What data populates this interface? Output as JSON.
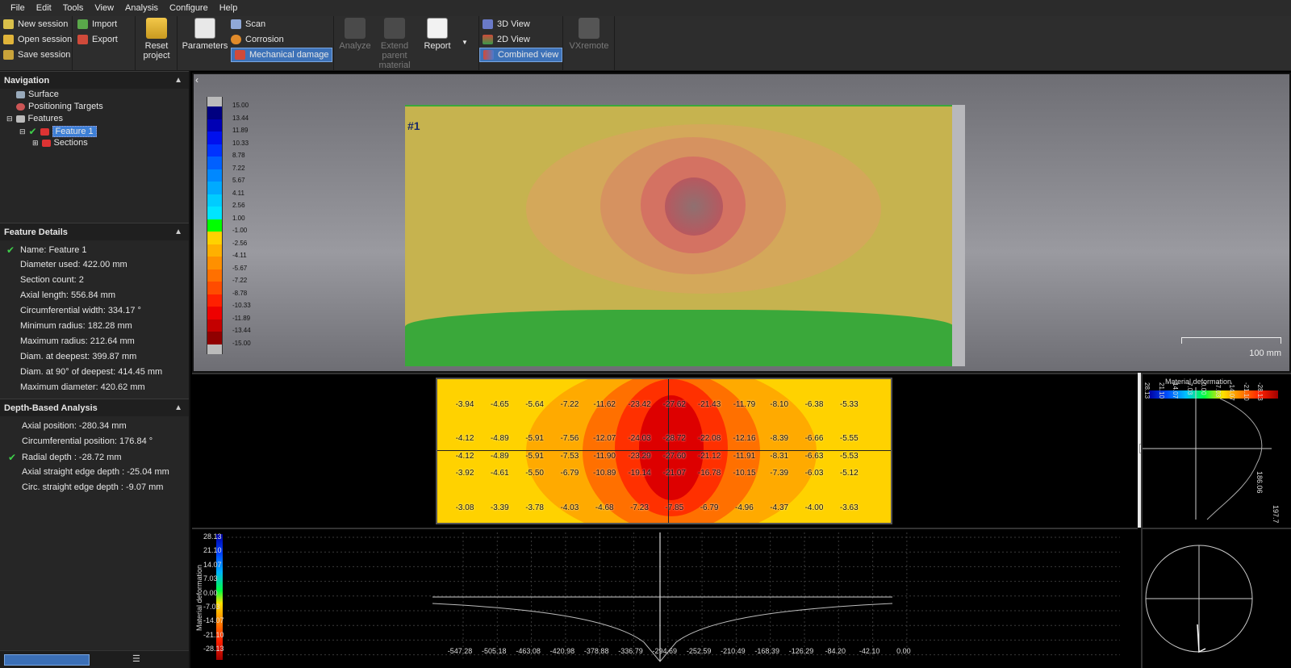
{
  "menu": [
    "File",
    "Edit",
    "Tools",
    "View",
    "Analysis",
    "Configure",
    "Help"
  ],
  "ribbon": {
    "session": {
      "new": "New session",
      "open": "Open session",
      "save": "Save session"
    },
    "io": {
      "import": "Import",
      "export": "Export"
    },
    "reset": [
      "Reset",
      "project"
    ],
    "parameters": "Parameters",
    "modes": {
      "scan": "Scan",
      "corrosion": "Corrosion",
      "mechanical": "Mechanical damage"
    },
    "analyze": "Analyze",
    "extend": [
      "Extend",
      "parent",
      "material"
    ],
    "report": "Report",
    "views": {
      "v3d": "3D View",
      "v2d": "2D View",
      "combined": "Combined view"
    },
    "vxremote": "VXremote"
  },
  "navigation": {
    "title": "Navigation",
    "items": {
      "surface": "Surface",
      "targets": "Positioning Targets",
      "features": "Features",
      "feature1": "Feature 1",
      "sections": "Sections"
    }
  },
  "feature_details": {
    "title": "Feature Details",
    "rows": [
      "Name: Feature 1",
      "Diameter used: 422.00 mm",
      "Section count: 2",
      "Axial length: 556.84 mm",
      "Circumferential width: 334.17 °",
      "Minimum radius: 182.28 mm",
      "Maximum radius: 212.64 mm",
      "Diam. at deepest: 399.87 mm",
      "Diam. at 90° of deepest: 414.45 mm",
      "Maximum diameter: 420.62 mm"
    ]
  },
  "depth_analysis": {
    "title": "Depth-Based Analysis",
    "rows": [
      "Axial position: -280.34 mm",
      "Circumferential position: 176.84 °",
      "Radial depth : -28.72 mm",
      "Axial straight edge depth : -25.04 mm",
      "Circ. straight edge depth : -9.07 mm"
    ]
  },
  "view3d": {
    "feature_tag": "#1",
    "scale_label": "100 mm",
    "colorbar_labels": [
      "15.00",
      "13.44",
      "11.89",
      "10.33",
      "8.78",
      "7.22",
      "5.67",
      "4.11",
      "2.56",
      "1.00",
      "-1.00",
      "-2.56",
      "-4.11",
      "-5.67",
      "-7.22",
      "-8.78",
      "-10.33",
      "-11.89",
      "-13.44",
      "-15.00"
    ],
    "colorbar_colors": [
      "#000080",
      "#0000b4",
      "#0010ee",
      "#0033ff",
      "#0060ff",
      "#0088ff",
      "#00aaff",
      "#00ccff",
      "#00e5ff",
      "#00ff00",
      "#ffd200",
      "#ffb000",
      "#ff9000",
      "#ff7000",
      "#ff4c00",
      "#ff2000",
      "#ee0000",
      "#c40000",
      "#900000"
    ]
  },
  "map2d": {
    "rows": [
      [
        "-3.94",
        "-4.65",
        "-5.64",
        "-7.22",
        "-11.62",
        "-23.42",
        "-27.62",
        "-21.43",
        "-11.79",
        "-8.10",
        "-6.38",
        "-5.33"
      ],
      [
        "-4.12",
        "-4.89",
        "-5.91",
        "-7.56",
        "-12.07",
        "-24.03",
        "-28.72",
        "-22.08",
        "-12.16",
        "-8.39",
        "-6.66",
        "-5.55"
      ],
      [
        "-4.12",
        "-4.89",
        "-5.91",
        "-7.53",
        "-11.90",
        "-23.29",
        "-27.60",
        "-21.12",
        "-11.91",
        "-8.31",
        "-6.63",
        "-5.53"
      ],
      [
        "-3.92",
        "-4.61",
        "-5.50",
        "-6.79",
        "-10.89",
        "-19.14",
        "-21.07",
        "-16.78",
        "-10.15",
        "-7.39",
        "-6.03",
        "-5.12"
      ],
      [
        "-3.08",
        "-3.39",
        "-3.78",
        "-4.03",
        "-4.68",
        "-7.23",
        "-7.85",
        "-6.79",
        "-4.96",
        "-4.37",
        "-4.00",
        "-3.63"
      ]
    ]
  },
  "profile": {
    "ylabel": "Material deformation",
    "yticks": [
      "28.13",
      "21.10",
      "14.07",
      "7.03",
      "0.00",
      "-7.03",
      "-14.07",
      "-21.10",
      "-28.13"
    ],
    "xticks": [
      "-547.28",
      "-505.18",
      "-463.08",
      "-420.98",
      "-378.88",
      "-336.79",
      "-294.69",
      "-252.59",
      "-210.49",
      "-168.39",
      "-126.29",
      "-84.20",
      "-42.10",
      "0.00"
    ]
  },
  "section_plot": {
    "title": "Material deformation",
    "ticks": [
      "28.13",
      "21.10",
      "14.07",
      "7.03",
      "0.00",
      "-7.03",
      "-14.07",
      "-21.10",
      "-28.13"
    ],
    "side_labels": [
      "186.06",
      "197.7"
    ]
  }
}
